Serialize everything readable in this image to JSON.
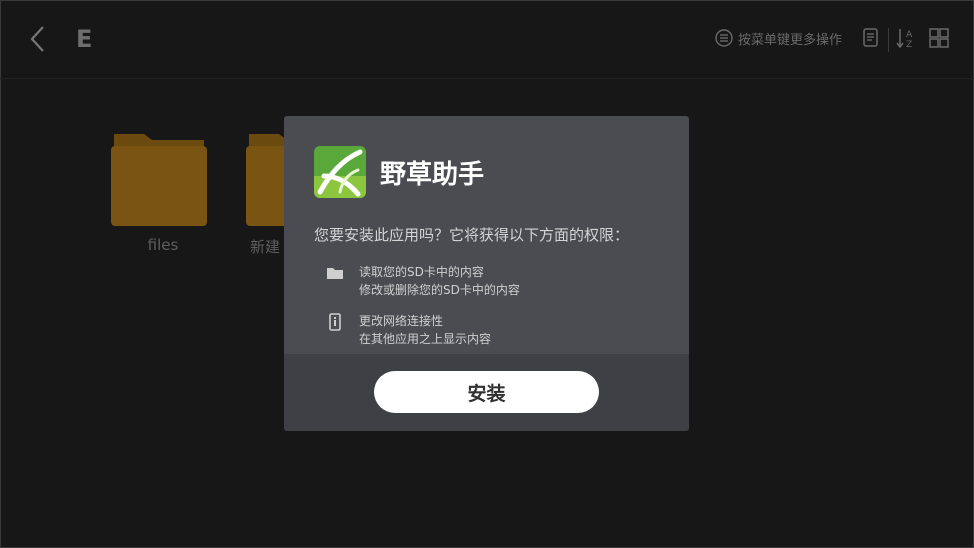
{
  "topbar": {
    "drive_letter": "E",
    "menu_hint": "按菜单键更多操作"
  },
  "folders": [
    {
      "name": "files"
    },
    {
      "name": "新建"
    }
  ],
  "dialog": {
    "app_name": "野草助手",
    "question": "您要安装此应用吗？它将获得以下方面的权限：",
    "permissions": [
      {
        "icon": "folder-icon",
        "lines": [
          "读取您的SD卡中的内容",
          "修改或删除您的SD卡中的内容"
        ]
      },
      {
        "icon": "phone-info-icon",
        "lines": [
          "更改网络连接性",
          "在其他应用之上显示内容"
        ]
      }
    ],
    "install_label": "安装"
  },
  "colors": {
    "background": "#171717",
    "dialog": "#4a4c52",
    "dialog_footer": "#3e4045",
    "folder": "#7a5412",
    "app_icon_green": "#5aa83a"
  }
}
